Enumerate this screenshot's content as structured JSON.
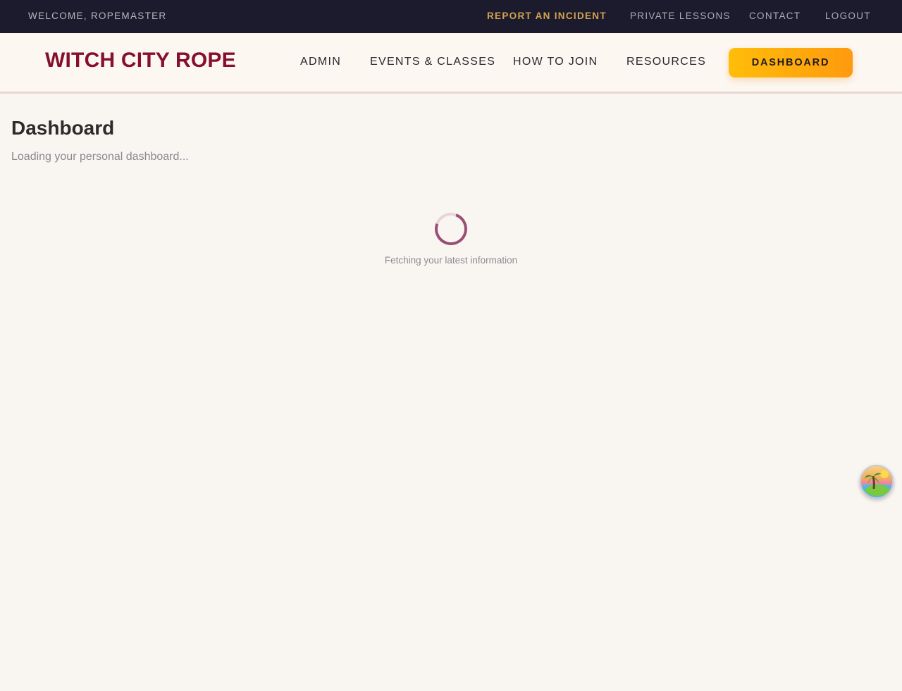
{
  "utility_bar": {
    "welcome": "WELCOME, ROPEMASTER",
    "links": {
      "report_incident": "REPORT AN INCIDENT",
      "private_lessons": "PRIVATE LESSONS",
      "contact": "CONTACT",
      "logout": "LOGOUT"
    }
  },
  "header": {
    "brand": "WITCH CITY ROPE",
    "nav": {
      "admin": "ADMIN",
      "events": "EVENTS & CLASSES",
      "join": "HOW TO JOIN",
      "resources": "RESOURCES"
    },
    "dashboard_button": "DASHBOARD"
  },
  "main": {
    "title": "Dashboard",
    "subtitle": "Loading your personal dashboard...",
    "loading_message": "Fetching your latest information"
  },
  "floating_widget": {
    "icon": "tropical-island-icon"
  },
  "colors": {
    "top_bar": "#1c1b2e",
    "brand": "#86102c",
    "accent": "#ffaa0d",
    "incident_link": "#d3a24f",
    "spinner": "#9b4f74",
    "page_background": "#f9f6f2"
  }
}
